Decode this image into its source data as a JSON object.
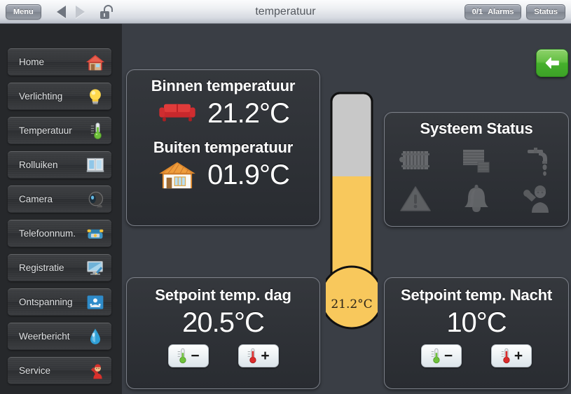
{
  "toolbar": {
    "menu_label": "Menu",
    "title": "temperatuur",
    "back_arrow_icon": "triangle-left-icon",
    "forward_arrow_icon": "triangle-right-icon",
    "lock_icon": "unlocked-padlock-icon",
    "alarms_count": "0/1",
    "alarms_label": "Alarms",
    "status_label": "Status"
  },
  "sidebar": {
    "items": [
      {
        "label": "Home",
        "icon": "house-icon"
      },
      {
        "label": "Verlichting",
        "icon": "lightbulb-icon"
      },
      {
        "label": "Temperatuur",
        "icon": "thermometer-icon"
      },
      {
        "label": "Rolluiken",
        "icon": "window-blinds-icon"
      },
      {
        "label": "Camera",
        "icon": "camera-icon"
      },
      {
        "label": "Telefoonnum.",
        "icon": "telephone-icon"
      },
      {
        "label": "Registratie",
        "icon": "monitor-pencil-icon"
      },
      {
        "label": "Ontspanning",
        "icon": "relaxation-icon"
      },
      {
        "label": "Weerbericht",
        "icon": "water-droplet-icon"
      },
      {
        "label": "Service",
        "icon": "service-worker-icon"
      }
    ]
  },
  "temperature_panel": {
    "inside_title": "Binnen temperatuur",
    "inside_value": "21.2°C",
    "inside_icon": "red-sofa-icon",
    "outside_title": "Buiten temperatuur",
    "outside_value": "01.9°C",
    "outside_icon": "orange-house-icon"
  },
  "thermometer": {
    "bulb_value": "21.2°C",
    "fill_percent": 62,
    "fill_color": "#f8c85c",
    "empty_color": "#c8c8c8"
  },
  "system_status": {
    "title": "Systeem Status",
    "icons": [
      {
        "name": "radiator-icon"
      },
      {
        "name": "blinds-icon"
      },
      {
        "name": "faucet-icon"
      },
      {
        "name": "warning-triangle-icon"
      },
      {
        "name": "bell-icon"
      },
      {
        "name": "service-worker-icon"
      }
    ]
  },
  "setpoint_day": {
    "title": "Setpoint temp. dag",
    "value": "20.5°C",
    "decrease_label": "−",
    "decrease_icon": "green-thermometer-icon",
    "increase_label": "+",
    "increase_icon": "red-thermometer-icon"
  },
  "setpoint_night": {
    "title": "Setpoint temp. Nacht",
    "value": "10°C",
    "decrease_label": "−",
    "decrease_icon": "green-thermometer-icon",
    "increase_label": "+",
    "increase_icon": "red-thermometer-icon"
  },
  "back_button": {
    "icon": "arrow-left-icon",
    "color": "#4cb32b"
  }
}
